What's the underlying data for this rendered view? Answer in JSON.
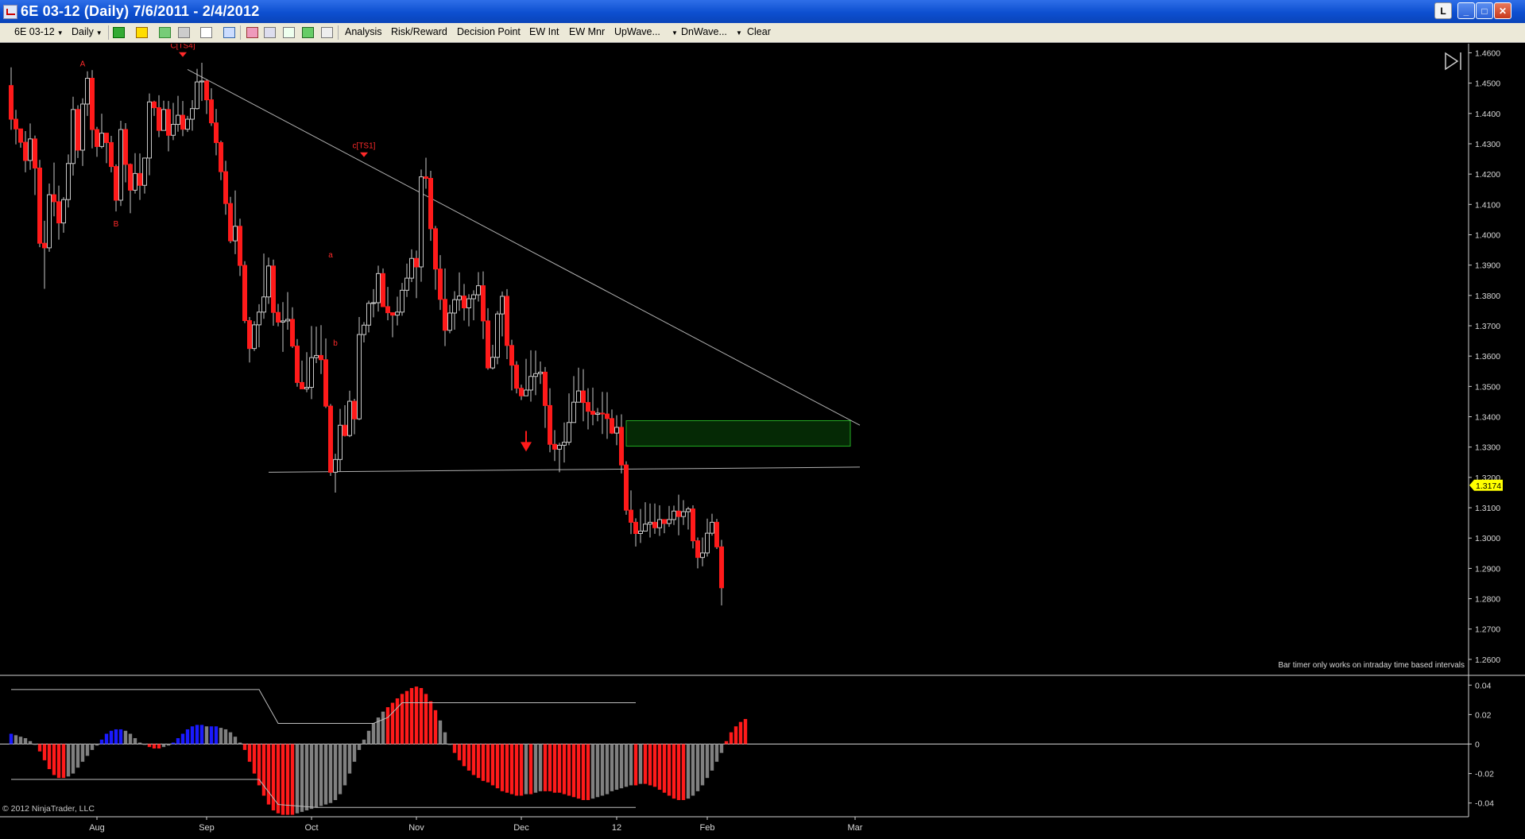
{
  "window": {
    "title": "6E 03-12 (Daily)  7/6/2011 - 2/4/2012",
    "btn_l": "L",
    "btn_min": "_",
    "btn_max": "□",
    "btn_close": "✕"
  },
  "toolbar": {
    "instrument": "6E 03-12",
    "interval": "Daily",
    "analysis": "Analysis",
    "risk_reward": "Risk/Reward",
    "decision_point": "Decision Point",
    "ew_int": "EW Int",
    "ew_mnr": "EW Mnr",
    "upwave": "UpWave...",
    "dnwave": "DnWave...",
    "clear": "Clear",
    "icons": [
      "bar-style-icon",
      "pencil-icon",
      "add-indicator-icon",
      "strategy-icon",
      "cursor-icon",
      "zoom-icon",
      "data-box-icon",
      "properties-icon",
      "chart-icon",
      "dollar-icon",
      "panel-icon"
    ]
  },
  "chart_data": {
    "type": "candlestick",
    "price_axis": {
      "min": 1.255,
      "max": 1.463,
      "ticks": [
        "1.4600",
        "1.4500",
        "1.4400",
        "1.4300",
        "1.4200",
        "1.4100",
        "1.4000",
        "1.3900",
        "1.3800",
        "1.3700",
        "1.3600",
        "1.3500",
        "1.3400",
        "1.3300",
        "1.3200",
        "1.3100",
        "1.3000",
        "1.2900",
        "1.2800",
        "1.2700",
        "1.2600"
      ]
    },
    "last_price": "1.3174",
    "date_axis": [
      "Aug",
      "Sep",
      "Oct",
      "Nov",
      "Dec",
      "12",
      "Feb",
      "Mar"
    ],
    "date_tick_bars": [
      18,
      41,
      63,
      85,
      107,
      127,
      146,
      177
    ],
    "bar_count": 153,
    "candles": [
      [
        1.4492,
        1.4381,
        1.4552,
        1.4346
      ],
      [
        1.4381,
        1.4349,
        1.4412,
        1.4298
      ],
      [
        1.4349,
        1.4305,
        1.4349,
        1.4287
      ],
      [
        1.4305,
        1.4245,
        1.4342,
        1.4206
      ],
      [
        1.4245,
        1.4316,
        1.4367,
        1.4214
      ],
      [
        1.4316,
        1.422,
        1.4327,
        1.4131
      ],
      [
        1.422,
        1.3972,
        1.4247,
        1.3959
      ],
      [
        1.3972,
        1.3957,
        1.4046,
        1.3822
      ],
      [
        1.3957,
        1.4132,
        1.4169,
        1.3944
      ],
      [
        1.4132,
        1.4109,
        1.4238,
        1.4061
      ],
      [
        1.4109,
        1.4039,
        1.4162,
        1.3984
      ],
      [
        1.4039,
        1.4116,
        1.4124,
        1.4007
      ],
      [
        1.4116,
        1.4235,
        1.4265,
        1.409
      ],
      [
        1.4235,
        1.4413,
        1.4455,
        1.4195
      ],
      [
        1.4413,
        1.4279,
        1.4427,
        1.4253
      ],
      [
        1.4279,
        1.4431,
        1.445,
        1.4227
      ],
      [
        1.4431,
        1.4516,
        1.4539,
        1.4392
      ],
      [
        1.4516,
        1.4347,
        1.4543,
        1.4285
      ],
      [
        1.4347,
        1.4291,
        1.4356,
        1.4257
      ],
      [
        1.4291,
        1.4335,
        1.4399,
        1.4285
      ],
      [
        1.4335,
        1.4304,
        1.4336,
        1.4236
      ],
      [
        1.4304,
        1.4225,
        1.4326,
        1.4206
      ],
      [
        1.4225,
        1.4114,
        1.4232,
        1.4077
      ],
      [
        1.4114,
        1.4347,
        1.4376,
        1.4095
      ],
      [
        1.4347,
        1.4232,
        1.4368,
        1.4173
      ],
      [
        1.4232,
        1.4147,
        1.4235,
        1.4071
      ],
      [
        1.4147,
        1.4202,
        1.4269,
        1.4136
      ],
      [
        1.4202,
        1.4163,
        1.4268,
        1.4115
      ],
      [
        1.4163,
        1.4253,
        1.4254,
        1.4136
      ],
      [
        1.4253,
        1.4438,
        1.4466,
        1.4196
      ],
      [
        1.4438,
        1.4419,
        1.4442,
        1.4392
      ],
      [
        1.4419,
        1.4344,
        1.446,
        1.4322
      ],
      [
        1.4344,
        1.4413,
        1.4442,
        1.4386
      ],
      [
        1.4413,
        1.4328,
        1.4441,
        1.4275
      ],
      [
        1.4328,
        1.4364,
        1.4435,
        1.4312
      ],
      [
        1.4364,
        1.4394,
        1.4458,
        1.434
      ],
      [
        1.4394,
        1.4348,
        1.4441,
        1.4325
      ],
      [
        1.4348,
        1.4381,
        1.4392,
        1.4339
      ],
      [
        1.4381,
        1.4416,
        1.4444,
        1.4343
      ],
      [
        1.4416,
        1.4504,
        1.4547,
        1.4413
      ],
      [
        1.4504,
        1.4507,
        1.4567,
        1.4441
      ],
      [
        1.4507,
        1.4445,
        1.4511,
        1.4398
      ],
      [
        1.4445,
        1.4369,
        1.4483,
        1.4359
      ],
      [
        1.4369,
        1.4304,
        1.4415,
        1.4262
      ],
      [
        1.4304,
        1.4208,
        1.431,
        1.418
      ],
      [
        1.4208,
        1.4103,
        1.4244,
        1.4066
      ],
      [
        1.4103,
        1.398,
        1.4125,
        1.3972
      ],
      [
        1.398,
        1.4028,
        1.4146,
        1.3936
      ],
      [
        1.4028,
        1.3899,
        1.4053,
        1.3864
      ],
      [
        1.3899,
        1.3717,
        1.3913,
        1.3709
      ],
      [
        1.3717,
        1.3625,
        1.3729,
        1.3579
      ],
      [
        1.3625,
        1.3703,
        1.3715,
        1.3617
      ],
      [
        1.3703,
        1.3745,
        1.3771,
        1.3629
      ],
      [
        1.3745,
        1.3795,
        1.3938,
        1.3723
      ],
      [
        1.3795,
        1.3897,
        1.3925,
        1.3772
      ],
      [
        1.3897,
        1.3744,
        1.3918,
        1.37
      ],
      [
        1.3744,
        1.3712,
        1.3772,
        1.3698
      ],
      [
        1.3712,
        1.3716,
        1.3778,
        1.3614
      ],
      [
        1.3716,
        1.3721,
        1.3811,
        1.3687
      ],
      [
        1.3721,
        1.3633,
        1.3761,
        1.3627
      ],
      [
        1.3633,
        1.3513,
        1.3656,
        1.3499
      ],
      [
        1.3513,
        1.3492,
        1.3585,
        1.3493
      ],
      [
        1.3492,
        1.3497,
        1.3613,
        1.3481
      ],
      [
        1.3497,
        1.3595,
        1.3699,
        1.3458
      ],
      [
        1.3595,
        1.3602,
        1.3697,
        1.3577
      ],
      [
        1.3602,
        1.3588,
        1.3702,
        1.3541
      ],
      [
        1.3588,
        1.3435,
        1.3658,
        1.3429
      ],
      [
        1.3435,
        1.3217,
        1.3442,
        1.3205
      ],
      [
        1.3217,
        1.3259,
        1.3278,
        1.315
      ],
      [
        1.3259,
        1.3372,
        1.3426,
        1.322
      ],
      [
        1.3372,
        1.3338,
        1.3438,
        1.3335
      ],
      [
        1.3338,
        1.3451,
        1.3486,
        1.3333
      ],
      [
        1.3451,
        1.3393,
        1.3459,
        1.3342
      ],
      [
        1.3393,
        1.3671,
        1.3729,
        1.3389
      ],
      [
        1.3671,
        1.3702,
        1.3712,
        1.3645
      ],
      [
        1.3702,
        1.3774,
        1.3783,
        1.3678
      ],
      [
        1.3774,
        1.3776,
        1.3821,
        1.3728
      ],
      [
        1.3776,
        1.3872,
        1.3898,
        1.3747
      ],
      [
        1.3872,
        1.3763,
        1.3889,
        1.3762
      ],
      [
        1.3763,
        1.3743,
        1.3828,
        1.3718
      ],
      [
        1.3743,
        1.3735,
        1.3743,
        1.3662
      ],
      [
        1.3735,
        1.3745,
        1.3796,
        1.3701
      ],
      [
        1.3745,
        1.3817,
        1.3841,
        1.3733
      ],
      [
        1.3817,
        1.3857,
        1.3905,
        1.3795
      ],
      [
        1.3857,
        1.3922,
        1.3952,
        1.3844
      ],
      [
        1.3922,
        1.3894,
        1.3948,
        1.3791
      ],
      [
        1.3894,
        1.4191,
        1.4215,
        1.3845
      ],
      [
        1.4191,
        1.4186,
        1.4254,
        1.4152
      ],
      [
        1.4186,
        1.402,
        1.4211,
        1.398
      ],
      [
        1.402,
        1.3887,
        1.4029,
        1.3819
      ],
      [
        1.3887,
        1.3787,
        1.3933,
        1.3752
      ],
      [
        1.3787,
        1.3685,
        1.3889,
        1.3633
      ],
      [
        1.3685,
        1.3742,
        1.3769,
        1.3675
      ],
      [
        1.3742,
        1.3786,
        1.3814,
        1.3687
      ],
      [
        1.3786,
        1.3798,
        1.3876,
        1.3749
      ],
      [
        1.3798,
        1.3759,
        1.3838,
        1.3717
      ],
      [
        1.3759,
        1.3789,
        1.3804,
        1.3698
      ],
      [
        1.3789,
        1.3802,
        1.3817,
        1.3718
      ],
      [
        1.3802,
        1.3832,
        1.3877,
        1.378
      ],
      [
        1.3832,
        1.3716,
        1.3879,
        1.3656
      ],
      [
        1.3716,
        1.3561,
        1.3758,
        1.3555
      ],
      [
        1.3561,
        1.3596,
        1.3637,
        1.3556
      ],
      [
        1.3596,
        1.3739,
        1.3748,
        1.3573
      ],
      [
        1.3739,
        1.3797,
        1.3813,
        1.3665
      ],
      [
        1.3797,
        1.3635,
        1.3821,
        1.359
      ],
      [
        1.3635,
        1.357,
        1.3654,
        1.3487
      ],
      [
        1.357,
        1.3494,
        1.3583,
        1.3477
      ],
      [
        1.3494,
        1.3469,
        1.3506,
        1.3455
      ],
      [
        1.3469,
        1.3488,
        1.3591,
        1.3473
      ],
      [
        1.3488,
        1.3533,
        1.3619,
        1.345
      ],
      [
        1.3533,
        1.3542,
        1.3618,
        1.3471
      ],
      [
        1.3542,
        1.3547,
        1.3582,
        1.3508
      ],
      [
        1.3547,
        1.3437,
        1.3564,
        1.3363
      ],
      [
        1.3437,
        1.3309,
        1.3494,
        1.3283
      ],
      [
        1.3309,
        1.3293,
        1.3356,
        1.3254
      ],
      [
        1.3293,
        1.3306,
        1.3314,
        1.3217
      ],
      [
        1.3306,
        1.3316,
        1.3381,
        1.3249
      ],
      [
        1.3316,
        1.3381,
        1.3477,
        1.3306
      ],
      [
        1.3381,
        1.3448,
        1.3534,
        1.3431
      ],
      [
        1.3448,
        1.3485,
        1.3562,
        1.3479
      ],
      [
        1.3485,
        1.3447,
        1.3557,
        1.3385
      ],
      [
        1.3447,
        1.3418,
        1.3494,
        1.3358
      ],
      [
        1.3418,
        1.3408,
        1.3496,
        1.3372
      ],
      [
        1.3408,
        1.3412,
        1.3429,
        1.3385
      ],
      [
        1.3412,
        1.3409,
        1.3482,
        1.3343
      ],
      [
        1.3409,
        1.3394,
        1.3481,
        1.3327
      ],
      [
        1.3394,
        1.3346,
        1.3424,
        1.3343
      ],
      [
        1.3346,
        1.3365,
        1.3405,
        1.3306
      ],
      [
        1.3365,
        1.3241,
        1.3408,
        1.3213
      ],
      [
        1.3241,
        1.3092,
        1.3253,
        1.3077
      ],
      [
        1.3092,
        1.3052,
        1.3157,
        1.3013
      ],
      [
        1.3052,
        1.3015,
        1.3065,
        1.2972
      ],
      [
        1.3015,
        1.3023,
        1.3096,
        1.2984
      ],
      [
        1.3023,
        1.3046,
        1.3118,
        1.3034
      ],
      [
        1.3046,
        1.3052,
        1.3114,
        1.3002
      ],
      [
        1.3052,
        1.3034,
        1.3114,
        1.3014
      ],
      [
        1.3034,
        1.3061,
        1.3108,
        1.3007
      ],
      [
        1.3061,
        1.3048,
        1.3062,
        1.3016
      ],
      [
        1.3048,
        1.3061,
        1.3106,
        1.3037
      ],
      [
        1.3061,
        1.3089,
        1.3107,
        1.3043
      ],
      [
        1.3089,
        1.3071,
        1.3143,
        1.3009
      ],
      [
        1.3071,
        1.3087,
        1.3125,
        1.3043
      ],
      [
        1.3087,
        1.3096,
        1.3103,
        1.3028
      ],
      [
        1.3096,
        1.2991,
        1.3108,
        1.2966
      ],
      [
        1.2991,
        1.2936,
        1.3002,
        1.29
      ],
      [
        1.2936,
        1.2951,
        1.3002,
        1.2907
      ],
      [
        1.2951,
        1.3016,
        1.3064,
        1.2939
      ],
      [
        1.3016,
        1.3052,
        1.308,
        1.3008
      ],
      [
        1.3052,
        1.2971,
        1.3063,
        1.2964
      ],
      [
        1.2971,
        1.2836,
        1.2994,
        1.2778
      ]
    ],
    "series_colors": {
      "up": "#c8c8c8",
      "down": "#ff1a1a",
      "wick": "#c8c8c8"
    },
    "annotations": [
      {
        "text": "A",
        "bar": 15,
        "price": 1.4555
      },
      {
        "text": "B",
        "bar": 22,
        "price": 1.4028
      },
      {
        "text": "C[TS4]",
        "bar": 36,
        "price": 1.4615
      },
      {
        "text": "a",
        "bar": 67,
        "price": 1.3925
      },
      {
        "text": "b",
        "bar": 68,
        "price": 1.3635
      },
      {
        "text": "c[TS1]",
        "bar": 74,
        "price": 1.4285
      }
    ],
    "trendlines": [
      {
        "from": [
          37,
          1.4545
        ],
        "to": [
          178,
          1.3372
        ]
      },
      {
        "from": [
          54,
          1.3217
        ],
        "to": [
          178,
          1.3234
        ]
      }
    ],
    "zone": {
      "from_bar": 129,
      "to_bar": 176,
      "top": 1.3387,
      "bottom": 1.3303,
      "color": "#0a5a0a"
    },
    "signal_arrow": {
      "bar": 108,
      "price": 1.3285,
      "color": "#ff1a1a"
    },
    "timer_note": "Bar timer only works on intraday time based intervals",
    "oscillator": {
      "axis": {
        "min": -0.045,
        "max": 0.045,
        "ticks": [
          "0.04",
          "0.02",
          "0",
          "-0.02",
          "-0.04"
        ]
      },
      "values": [
        0.007,
        0.006,
        0.005,
        0.004,
        0.002,
        0,
        -0.005,
        -0.011,
        -0.017,
        -0.021,
        -0.023,
        -0.023,
        -0.022,
        -0.02,
        -0.016,
        -0.012,
        -0.008,
        -0.004,
        -0.001,
        0.003,
        0.007,
        0.009,
        0.01,
        0.01,
        0.009,
        0.007,
        0.004,
        0.001,
        0,
        -0.002,
        -0.003,
        -0.003,
        -0.002,
        -0.001,
        0.001,
        0.004,
        0.007,
        0.01,
        0.012,
        0.013,
        0.013,
        0.012,
        0.012,
        0.012,
        0.011,
        0.01,
        0.008,
        0.005,
        0.001,
        -0.004,
        -0.012,
        -0.02,
        -0.028,
        -0.035,
        -0.041,
        -0.045,
        -0.047,
        -0.048,
        -0.048,
        -0.048,
        -0.047,
        -0.046,
        -0.045,
        -0.044,
        -0.043,
        -0.042,
        -0.041,
        -0.04,
        -0.038,
        -0.034,
        -0.028,
        -0.02,
        -0.012,
        -0.004,
        0.003,
        0.009,
        0.014,
        0.018,
        0.022,
        0.025,
        0.028,
        0.031,
        0.034,
        0.036,
        0.038,
        0.039,
        0.038,
        0.034,
        0.029,
        0.023,
        0.016,
        0.008,
        0,
        -0.006,
        -0.011,
        -0.015,
        -0.018,
        -0.021,
        -0.023,
        -0.025,
        -0.026,
        -0.028,
        -0.03,
        -0.032,
        -0.033,
        -0.034,
        -0.035,
        -0.035,
        -0.034,
        -0.034,
        -0.033,
        -0.032,
        -0.032,
        -0.032,
        -0.033,
        -0.033,
        -0.034,
        -0.035,
        -0.036,
        -0.037,
        -0.038,
        -0.038,
        -0.037,
        -0.036,
        -0.035,
        -0.034,
        -0.032,
        -0.031,
        -0.03,
        -0.029,
        -0.028,
        -0.028,
        -0.027,
        -0.027,
        -0.028,
        -0.029,
        -0.031,
        -0.033,
        -0.035,
        -0.037,
        -0.038,
        -0.038,
        -0.037,
        -0.035,
        -0.032,
        -0.028,
        -0.023,
        -0.018,
        -0.012,
        -0.006,
        0.002,
        0.008,
        0.012,
        0.015,
        0.017
      ],
      "colors": {
        "positive": "#1a1aff",
        "neutral": "#808080",
        "negative": "#ff1a1a"
      },
      "upper_band": [
        [
          0,
          0.037
        ],
        [
          52,
          0.037
        ],
        [
          56,
          0.014
        ],
        [
          76,
          0.014
        ],
        [
          79,
          0.018
        ],
        [
          82,
          0.028
        ],
        [
          131,
          0.028
        ]
      ],
      "lower_band": [
        [
          0,
          -0.024
        ],
        [
          52,
          -0.024
        ],
        [
          56,
          -0.041
        ],
        [
          64,
          -0.043
        ],
        [
          131,
          -0.043
        ]
      ]
    },
    "copyright": "© 2012 NinjaTrader, LLC"
  }
}
